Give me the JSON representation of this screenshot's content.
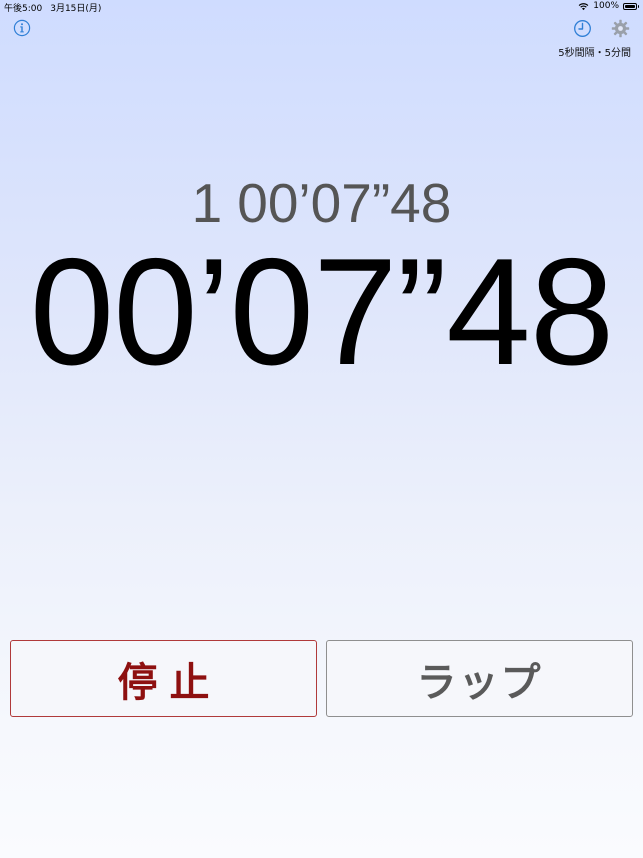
{
  "status_bar": {
    "time": "午後5:00",
    "date": "3月15日(月)",
    "battery_text": "100%",
    "battery_level": 1.0
  },
  "header": {
    "info_icon": "info-circle-icon",
    "history_icon": "clock-icon",
    "settings_icon": "gear-icon",
    "interval_label": "5秒間隔・5分間"
  },
  "timer": {
    "lap_number": "1",
    "lap_time": "00’07”48",
    "main_time": "00’07”48"
  },
  "buttons": {
    "stop_label": "停止",
    "lap_label": "ラップ"
  },
  "colors": {
    "accent_blue": "#2f7fd6",
    "gear_gray": "#9aa0aa",
    "stop_red": "#8e1010",
    "lap_gray": "#5a5a5a"
  }
}
